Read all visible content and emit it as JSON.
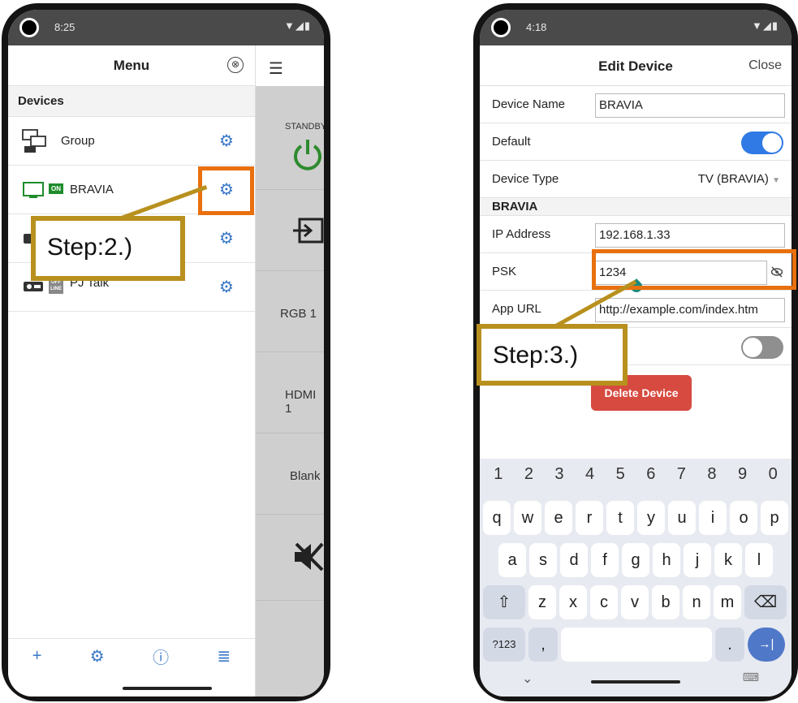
{
  "left_phone": {
    "status": {
      "time": "8:25",
      "icons": "▼◢▮"
    },
    "drawer": {
      "title": "Menu",
      "close_icon": "⊗",
      "section": "Devices",
      "devices": [
        {
          "label": "Group",
          "icon": "group-monitors-icon"
        },
        {
          "label": "BRAVIA",
          "icon": "tv-icon",
          "badge": "ON"
        },
        {
          "label": "",
          "icon": "projector-icon"
        },
        {
          "label": "PJ Talk",
          "icon": "projector-icon",
          "badge": "OFF LINE"
        }
      ],
      "bottom_bar": [
        "+",
        "⚙",
        "ⓘ",
        "≣"
      ]
    },
    "remote": {
      "hamburger": "☰",
      "buttons": [
        "STANDBY",
        "",
        "RGB 1",
        "HDMI 1",
        "Blank",
        ""
      ]
    }
  },
  "right_phone": {
    "status": {
      "time": "4:18",
      "icons": "▼◢▮"
    },
    "header": {
      "title": "Edit Device",
      "close": "Close"
    },
    "fields": {
      "device_name_label": "Device Name",
      "device_name_value": "BRAVIA",
      "default_label": "Default",
      "default_on": true,
      "device_type_label": "Device Type",
      "device_type_value": "TV (BRAVIA)",
      "section_bravia": "BRAVIA",
      "ip_label": "IP Address",
      "ip_value": "192.168.1.33",
      "psk_label": "PSK",
      "psk_value": "1234",
      "app_url_label": "App URL",
      "app_url_value": "http://example.com/index.htm",
      "extra_toggle_on": false
    },
    "delete_label": "Delete Device",
    "keyboard": {
      "numbers": [
        "1",
        "2",
        "3",
        "4",
        "5",
        "6",
        "7",
        "8",
        "9",
        "0"
      ],
      "row1": [
        "q",
        "w",
        "e",
        "r",
        "t",
        "y",
        "u",
        "i",
        "o",
        "p"
      ],
      "row2": [
        "a",
        "s",
        "d",
        "f",
        "g",
        "h",
        "j",
        "k",
        "l"
      ],
      "row3": [
        "z",
        "x",
        "c",
        "v",
        "b",
        "n",
        "m"
      ],
      "shift": "⇧",
      "backspace": "⌫",
      "symbols": "?123",
      "comma": ",",
      "period": ".",
      "enter": "→|",
      "collapse": "⌄",
      "keyboard_icon": "⌨"
    }
  },
  "annotations": {
    "step2": "Step:2.)",
    "step3": "Step:3.)"
  },
  "colors": {
    "accent_blue": "#3a78c8",
    "toggle_on": "#2f7ae5",
    "highlight_orange": "#e8700e",
    "callout_gold": "#b8901e",
    "delete_red": "#d64a40",
    "power_green": "#2e8b2e"
  }
}
